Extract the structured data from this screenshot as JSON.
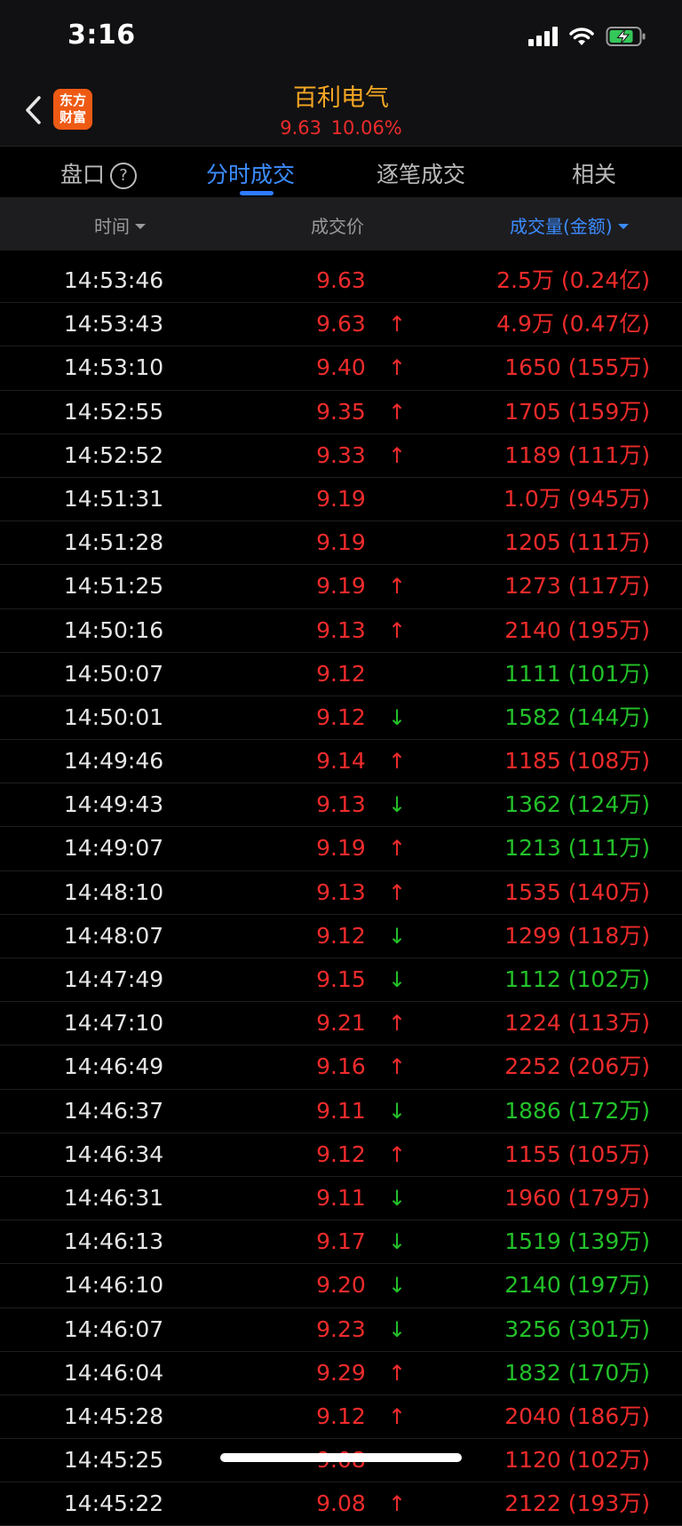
{
  "status_bar": {
    "time": "3:16",
    "icons": [
      "signal-icon",
      "wifi-icon",
      "battery-charging-icon"
    ]
  },
  "header": {
    "back_icon": "chevron-left-icon",
    "logo_line1": "东方",
    "logo_line2": "财富",
    "stock_name": "百利电气",
    "price": "9.63",
    "change_pct": "10.06%",
    "accent_color": "#f5a623",
    "up_color": "#ee2b2b"
  },
  "tabs": [
    {
      "label": "盘口",
      "help": "?"
    },
    {
      "label": "分时成交",
      "active": true
    },
    {
      "label": "逐笔成交"
    },
    {
      "label": "相关"
    }
  ],
  "columns": {
    "time": "时间",
    "price": "成交价",
    "volume": "成交量(金额)"
  },
  "colors": {
    "up": "#ee2b2b",
    "down": "#23c12a",
    "active_tab": "#3c8cff"
  },
  "trades": [
    {
      "time": "14:53:46",
      "price": "9.63",
      "arrow": "",
      "volume": "2.5万 (0.24亿)",
      "price_color": "red",
      "volume_color": "red"
    },
    {
      "time": "14:53:43",
      "price": "9.63",
      "arrow": "↑",
      "volume": "4.9万 (0.47亿)",
      "price_color": "red",
      "volume_color": "red"
    },
    {
      "time": "14:53:10",
      "price": "9.40",
      "arrow": "↑",
      "volume": "1650 (155万)",
      "price_color": "red",
      "volume_color": "red"
    },
    {
      "time": "14:52:55",
      "price": "9.35",
      "arrow": "↑",
      "volume": "1705 (159万)",
      "price_color": "red",
      "volume_color": "red"
    },
    {
      "time": "14:52:52",
      "price": "9.33",
      "arrow": "↑",
      "volume": "1189 (111万)",
      "price_color": "red",
      "volume_color": "red"
    },
    {
      "time": "14:51:31",
      "price": "9.19",
      "arrow": "",
      "volume": "1.0万 (945万)",
      "price_color": "red",
      "volume_color": "red"
    },
    {
      "time": "14:51:28",
      "price": "9.19",
      "arrow": "",
      "volume": "1205 (111万)",
      "price_color": "red",
      "volume_color": "red"
    },
    {
      "time": "14:51:25",
      "price": "9.19",
      "arrow": "↑",
      "volume": "1273 (117万)",
      "price_color": "red",
      "volume_color": "red"
    },
    {
      "time": "14:50:16",
      "price": "9.13",
      "arrow": "↑",
      "volume": "2140 (195万)",
      "price_color": "red",
      "volume_color": "red"
    },
    {
      "time": "14:50:07",
      "price": "9.12",
      "arrow": "",
      "volume": "1111 (101万)",
      "price_color": "red",
      "volume_color": "green"
    },
    {
      "time": "14:50:01",
      "price": "9.12",
      "arrow": "↓",
      "volume": "1582 (144万)",
      "price_color": "red",
      "volume_color": "green"
    },
    {
      "time": "14:49:46",
      "price": "9.14",
      "arrow": "↑",
      "volume": "1185 (108万)",
      "price_color": "red",
      "volume_color": "red"
    },
    {
      "time": "14:49:43",
      "price": "9.13",
      "arrow": "↓",
      "volume": "1362 (124万)",
      "price_color": "red",
      "volume_color": "green"
    },
    {
      "time": "14:49:07",
      "price": "9.19",
      "arrow": "↑",
      "volume": "1213 (111万)",
      "price_color": "red",
      "volume_color": "green"
    },
    {
      "time": "14:48:10",
      "price": "9.13",
      "arrow": "↑",
      "volume": "1535 (140万)",
      "price_color": "red",
      "volume_color": "red"
    },
    {
      "time": "14:48:07",
      "price": "9.12",
      "arrow": "↓",
      "volume": "1299 (118万)",
      "price_color": "red",
      "volume_color": "red"
    },
    {
      "time": "14:47:49",
      "price": "9.15",
      "arrow": "↓",
      "volume": "1112 (102万)",
      "price_color": "red",
      "volume_color": "green"
    },
    {
      "time": "14:47:10",
      "price": "9.21",
      "arrow": "↑",
      "volume": "1224 (113万)",
      "price_color": "red",
      "volume_color": "red"
    },
    {
      "time": "14:46:49",
      "price": "9.16",
      "arrow": "↑",
      "volume": "2252 (206万)",
      "price_color": "red",
      "volume_color": "red"
    },
    {
      "time": "14:46:37",
      "price": "9.11",
      "arrow": "↓",
      "volume": "1886 (172万)",
      "price_color": "red",
      "volume_color": "green"
    },
    {
      "time": "14:46:34",
      "price": "9.12",
      "arrow": "↑",
      "volume": "1155 (105万)",
      "price_color": "red",
      "volume_color": "red"
    },
    {
      "time": "14:46:31",
      "price": "9.11",
      "arrow": "↓",
      "volume": "1960 (179万)",
      "price_color": "red",
      "volume_color": "red"
    },
    {
      "time": "14:46:13",
      "price": "9.17",
      "arrow": "↓",
      "volume": "1519 (139万)",
      "price_color": "red",
      "volume_color": "green"
    },
    {
      "time": "14:46:10",
      "price": "9.20",
      "arrow": "↓",
      "volume": "2140 (197万)",
      "price_color": "red",
      "volume_color": "green"
    },
    {
      "time": "14:46:07",
      "price": "9.23",
      "arrow": "↓",
      "volume": "3256 (301万)",
      "price_color": "red",
      "volume_color": "green"
    },
    {
      "time": "14:46:04",
      "price": "9.29",
      "arrow": "↑",
      "volume": "1832 (170万)",
      "price_color": "red",
      "volume_color": "green"
    },
    {
      "time": "14:45:28",
      "price": "9.12",
      "arrow": "↑",
      "volume": "2040 (186万)",
      "price_color": "red",
      "volume_color": "red"
    },
    {
      "time": "14:45:25",
      "price": "9.08",
      "arrow": "",
      "volume": "1120 (102万)",
      "price_color": "red",
      "volume_color": "red"
    },
    {
      "time": "14:45:22",
      "price": "9.08",
      "arrow": "↑",
      "volume": "2122 (193万)",
      "price_color": "red",
      "volume_color": "red"
    }
  ]
}
